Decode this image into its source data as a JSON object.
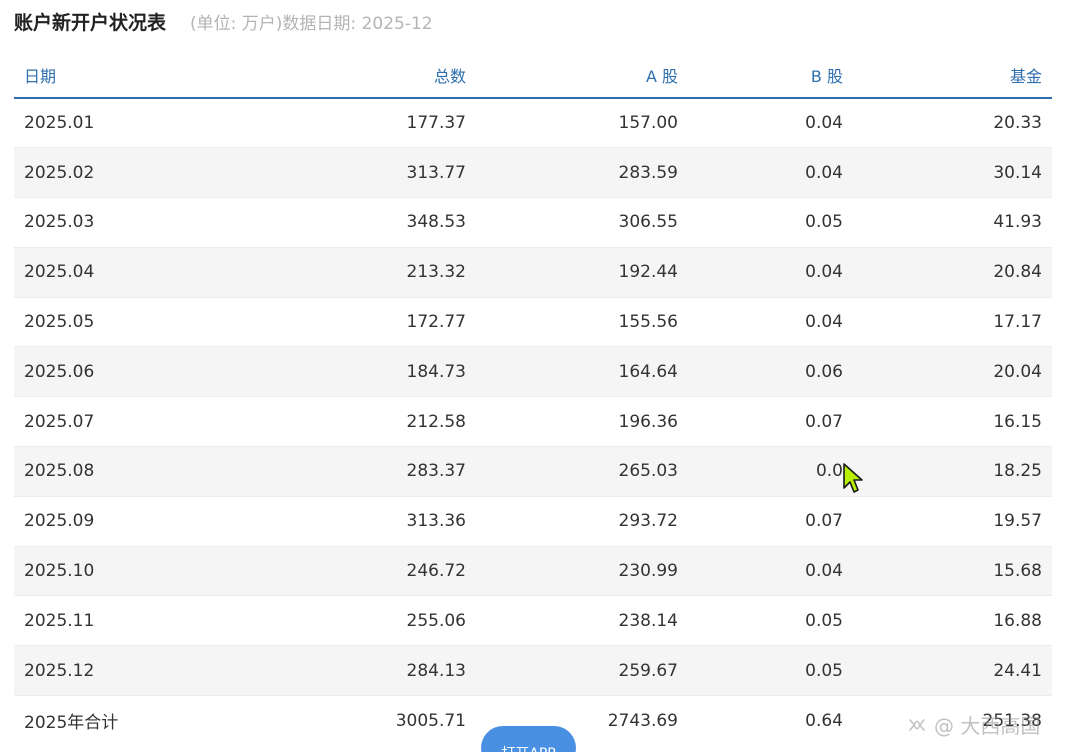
{
  "header": {
    "title": "账户新开户状况表",
    "unit": "(单位: 万户)",
    "date_label": "数据日期:",
    "date_value": "2025-12"
  },
  "table": {
    "columns": [
      "日期",
      "总数",
      "A 股",
      "B 股",
      "基金"
    ],
    "rows": [
      [
        "2025.01",
        "177.37",
        "157.00",
        "0.04",
        "20.33"
      ],
      [
        "2025.02",
        "313.77",
        "283.59",
        "0.04",
        "30.14"
      ],
      [
        "2025.03",
        "348.53",
        "306.55",
        "0.05",
        "41.93"
      ],
      [
        "2025.04",
        "213.32",
        "192.44",
        "0.04",
        "20.84"
      ],
      [
        "2025.05",
        "172.77",
        "155.56",
        "0.04",
        "17.17"
      ],
      [
        "2025.06",
        "184.73",
        "164.64",
        "0.06",
        "20.04"
      ],
      [
        "2025.07",
        "212.58",
        "196.36",
        "0.07",
        "16.15"
      ],
      [
        "2025.08",
        "283.37",
        "265.03",
        "0.0",
        "18.25"
      ],
      [
        "2025.09",
        "313.36",
        "293.72",
        "0.07",
        "19.57"
      ],
      [
        "2025.10",
        "246.72",
        "230.99",
        "0.04",
        "15.68"
      ],
      [
        "2025.11",
        "255.06",
        "238.14",
        "0.05",
        "16.88"
      ],
      [
        "2025.12",
        "284.13",
        "259.67",
        "0.05",
        "24.41"
      ],
      [
        "2025年合计",
        "3005.71",
        "2743.69",
        "0.64",
        "251.38"
      ]
    ]
  },
  "open_app_button": {
    "label": "打开APP"
  },
  "watermark": {
    "text": "@ 大西高国"
  },
  "colors": {
    "header_text": "#2f6fb0",
    "header_rule": "#2f6fb0",
    "row_alt": "#f5f5f5",
    "button": "#4a90e2"
  },
  "icons": {
    "cursor": "mouse-pointer-icon",
    "watermark": "wechat-channel-icon"
  }
}
